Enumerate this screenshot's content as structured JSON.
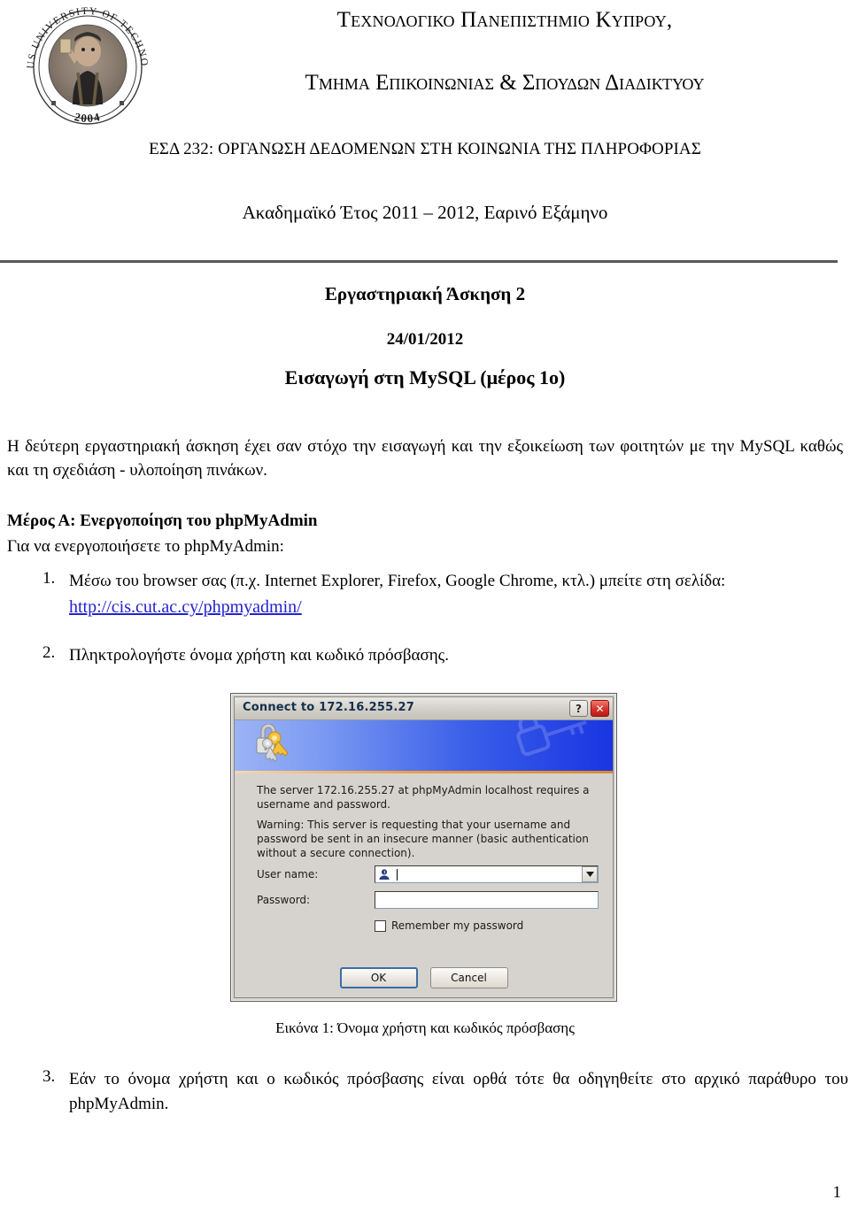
{
  "header": {
    "university": "Τεχνολογικο Πανεπιστημιο Κυπρου,",
    "department": "Τμημα Επικοινωνιας & Σπουδων Διαδικτυου",
    "course": "ΕΣΔ 232: ΟΡΓΑΝΩΣΗ ΔΕΔΟΜΕΝΩΝ ΣΤΗ ΚΟΙΝΩΝΙΑ ΤΗΣ ΠΛΗΡΟΦΟΡΙΑΣ",
    "academic_year": "Ακαδημαϊκό Έτος 2011 – 2012, Εαρινό Εξάμηνο",
    "logo_alt": "university-seal",
    "logo_text_top": "CYPRUS UNIVERSITY OF TECHNOLOGY",
    "logo_year": "2004"
  },
  "titles": {
    "lab_title": "Εργαστηριακή Άσκηση 2",
    "lab_date": "24/01/2012",
    "lab_subject": "Εισαγωγή στη MySQL (μέρος 1ο)"
  },
  "body": {
    "intro": "Η δεύτερη εργαστηριακή άσκηση έχει σαν στόχο την εισαγωγή και την εξοικείωση των φοιτητών με την MySQL καθώς και τη σχεδιάση - υλοποίηση πινάκων.",
    "part_a_heading": "Μέρος Α: Ενεργοποίηση του phpMyAdmin",
    "part_a_sub": "Για να ενεργοποιήσετε το phpMyAdmin:",
    "step1_num": "1.",
    "step1_text": "Μέσω του browser σας (π.χ. Internet Explorer, Firefox, Google Chrome, κτλ.) μπείτε στη σελίδα:",
    "step1_link": "http://cis.cut.ac.cy/phpmyadmin/",
    "step2_num": "2.",
    "step2_text": "Πληκτρολογήστε όνομα χρήστη και κωδικό πρόσβασης.",
    "step3_num": "3.",
    "step3_text": "Εάν το όνομα χρήστη και ο κωδικός πρόσβασης είναι ορθά τότε θα οδηγηθείτε στο αρχικό παράθυρο του phpMyAdmin.",
    "figure_caption": "Εικόνα 1: Όνομα χρήστη και κωδικός πρόσβασης",
    "page_number": "1"
  },
  "dialog": {
    "title": "Connect to 172.16.255.27",
    "help_button": "?",
    "close_button": "✕",
    "banner_icon_name": "lock-and-keys-icon",
    "message_line1": "The server  172.16.255.27 at phpMyAdmin localhost requires a username and password.",
    "message_line2": "Warning: This server is requesting that your username and password be sent in an insecure manner (basic authentication without a secure connection).",
    "username_label": "User name:",
    "username_value": "",
    "password_label": "Password:",
    "password_value": "",
    "remember_label": "Remember my password",
    "remember_checked": false,
    "ok_button": "OK",
    "cancel_button": "Cancel"
  },
  "colors": {
    "link": "#2222cc",
    "title_text": "#14314f",
    "banner_left": "#9cb4f4",
    "banner_right": "#1a35e2",
    "banner_rule": "#e8a14c",
    "dialog_face": "#d6d3ce",
    "close_button": "#d7322a",
    "rule": "#58585a"
  }
}
